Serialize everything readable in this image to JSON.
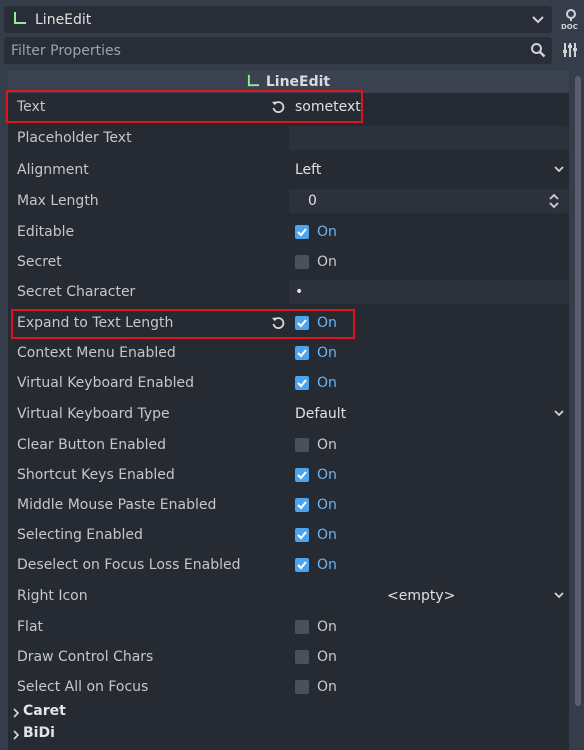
{
  "header": {
    "node_type": "LineEdit",
    "filter_placeholder": "Filter Properties"
  },
  "section": {
    "title": "LineEdit"
  },
  "properties": {
    "text": {
      "label": "Text",
      "value": "sometext"
    },
    "placeholder_text": {
      "label": "Placeholder Text",
      "value": ""
    },
    "alignment": {
      "label": "Alignment",
      "value": "Left"
    },
    "max_length": {
      "label": "Max Length",
      "value": "0"
    },
    "editable": {
      "label": "Editable",
      "state": "On",
      "checked": true
    },
    "secret": {
      "label": "Secret",
      "state": "On",
      "checked": false
    },
    "secret_character": {
      "label": "Secret Character",
      "value": "•"
    },
    "expand_to_text_length": {
      "label": "Expand to Text Length",
      "state": "On",
      "checked": true
    },
    "context_menu_enabled": {
      "label": "Context Menu Enabled",
      "state": "On",
      "checked": true
    },
    "virtual_keyboard_enabled": {
      "label": "Virtual Keyboard Enabled",
      "state": "On",
      "checked": true
    },
    "virtual_keyboard_type": {
      "label": "Virtual Keyboard Type",
      "value": "Default"
    },
    "clear_button_enabled": {
      "label": "Clear Button Enabled",
      "state": "On",
      "checked": false
    },
    "shortcut_keys_enabled": {
      "label": "Shortcut Keys Enabled",
      "state": "On",
      "checked": true
    },
    "middle_mouse_paste_enabled": {
      "label": "Middle Mouse Paste Enabled",
      "state": "On",
      "checked": true
    },
    "selecting_enabled": {
      "label": "Selecting Enabled",
      "state": "On",
      "checked": true
    },
    "deselect_on_focus_loss_enabled": {
      "label": "Deselect on Focus Loss Enabled",
      "state": "On",
      "checked": true
    },
    "right_icon": {
      "label": "Right Icon",
      "value": "<empty>"
    },
    "flat": {
      "label": "Flat",
      "state": "On",
      "checked": false
    },
    "draw_control_chars": {
      "label": "Draw Control Chars",
      "state": "On",
      "checked": false
    },
    "select_all_on_focus": {
      "label": "Select All on Focus",
      "state": "On",
      "checked": false
    }
  },
  "subsections": {
    "caret": "Caret",
    "bidi": "BiDi"
  },
  "colors": {
    "accent": "#4ca4ee",
    "highlight": "#e0141e",
    "node_icon": "#8eef97"
  },
  "icons": {
    "node": "lineedit-icon",
    "doc": "doc-icon",
    "search": "search-icon",
    "tools": "tools-icon",
    "revert": "revert-icon"
  }
}
